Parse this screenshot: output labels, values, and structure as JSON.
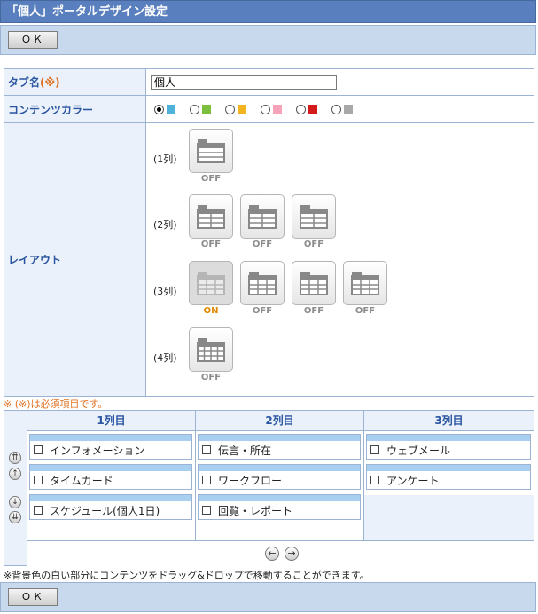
{
  "header": {
    "title": "「個人」ポータルデザイン設定"
  },
  "buttons": {
    "ok_top": "ＯＫ",
    "ok_bottom": "ＯＫ"
  },
  "form": {
    "tab_name_label": "タブ名",
    "required_mark": "(※)",
    "tab_name_value": "個人",
    "content_color_label": "コンテンツカラー",
    "colors": [
      "#4fb2d8",
      "#7cbf3d",
      "#f2b520",
      "#f5a3b8",
      "#d41a1a",
      "#a8a8a8"
    ],
    "selected_color_index": 0,
    "layout_label": "レイアウト",
    "layout_rows": [
      {
        "label": "(1列)",
        "items": [
          {
            "status": "OFF",
            "on": false,
            "icon": "layout-1col-icon"
          }
        ]
      },
      {
        "label": "(2列)",
        "items": [
          {
            "status": "OFF",
            "on": false,
            "icon": "layout-2col-a-icon"
          },
          {
            "status": "OFF",
            "on": false,
            "icon": "layout-2col-b-icon"
          },
          {
            "status": "OFF",
            "on": false,
            "icon": "layout-2col-c-icon"
          }
        ]
      },
      {
        "label": "(3列)",
        "items": [
          {
            "status": "ON",
            "on": true,
            "icon": "layout-3col-a-icon"
          },
          {
            "status": "OFF",
            "on": false,
            "icon": "layout-3col-b-icon"
          },
          {
            "status": "OFF",
            "on": false,
            "icon": "layout-3col-c-icon"
          },
          {
            "status": "OFF",
            "on": false,
            "icon": "layout-3col-d-icon"
          }
        ]
      },
      {
        "label": "(4列)",
        "items": [
          {
            "status": "OFF",
            "on": false,
            "icon": "layout-4col-icon"
          }
        ]
      }
    ]
  },
  "notes": {
    "required": "※ (※)は必須項目です。",
    "drag": "※背景色の白い部分にコンテンツをドラッグ&ドロップで移動することができます。"
  },
  "arrangement": {
    "columns": [
      {
        "header": "1列目",
        "items": [
          "インフォメーション",
          "タイムカード",
          "スケジュール(個人1日)"
        ]
      },
      {
        "header": "2列目",
        "items": [
          "伝言・所在",
          "ワークフロー",
          "回覧・レポート"
        ]
      },
      {
        "header": "3列目",
        "items": [
          "ウェブメール",
          "アンケート"
        ]
      }
    ]
  }
}
